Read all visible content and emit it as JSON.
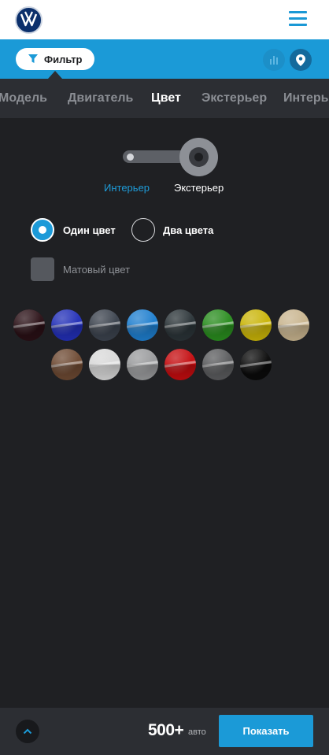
{
  "header": {
    "logo": "vw-logo",
    "menu_icon": "hamburger-icon"
  },
  "filterbar": {
    "filter_label": "Фильтр",
    "filter_icon": "funnel-icon",
    "stats_icon": "bar-chart-icon",
    "map_icon": "map-pin-icon"
  },
  "tabs": [
    {
      "label": "Модель",
      "active": false
    },
    {
      "label": "Двигатель",
      "active": false
    },
    {
      "label": "Цвет",
      "active": true
    },
    {
      "label": "Экстерьер",
      "active": false
    },
    {
      "label": "Интерьер",
      "active": false
    }
  ],
  "color_panel": {
    "toggle_left": "Интерьер",
    "toggle_right": "Экстерьер",
    "selected_side": "Экстерьер",
    "radio_one": "Один цвет",
    "radio_two": "Два цвета",
    "radio_selected": "Один цвет",
    "matte_label": "Матовый цвет",
    "matte_checked": false,
    "swatches": [
      {
        "name": "dark-burgundy",
        "color": "#2a1016"
      },
      {
        "name": "blue",
        "color": "#2330b8"
      },
      {
        "name": "dark-grey",
        "color": "#3c434e"
      },
      {
        "name": "light-blue",
        "color": "#1f7fcf"
      },
      {
        "name": "dark-slate",
        "color": "#2b3438"
      },
      {
        "name": "green",
        "color": "#2a8d1f"
      },
      {
        "name": "yellow",
        "color": "#cab509"
      },
      {
        "name": "beige",
        "color": "#c9b58f"
      },
      {
        "name": "brown",
        "color": "#6e4a33"
      },
      {
        "name": "white",
        "color": "#d9d9d9"
      },
      {
        "name": "silver",
        "color": "#9a9b9d"
      },
      {
        "name": "red",
        "color": "#c50d10"
      },
      {
        "name": "grey",
        "color": "#5b5c5e"
      },
      {
        "name": "black",
        "color": "#0b0b0b"
      }
    ]
  },
  "bottombar": {
    "up_icon": "chevron-up-icon",
    "count": "500+",
    "count_unit": "авто",
    "show_label": "Показать"
  },
  "colors": {
    "accent": "#1b9ad7",
    "background": "#1f2023",
    "bar": "#2c2e33"
  }
}
